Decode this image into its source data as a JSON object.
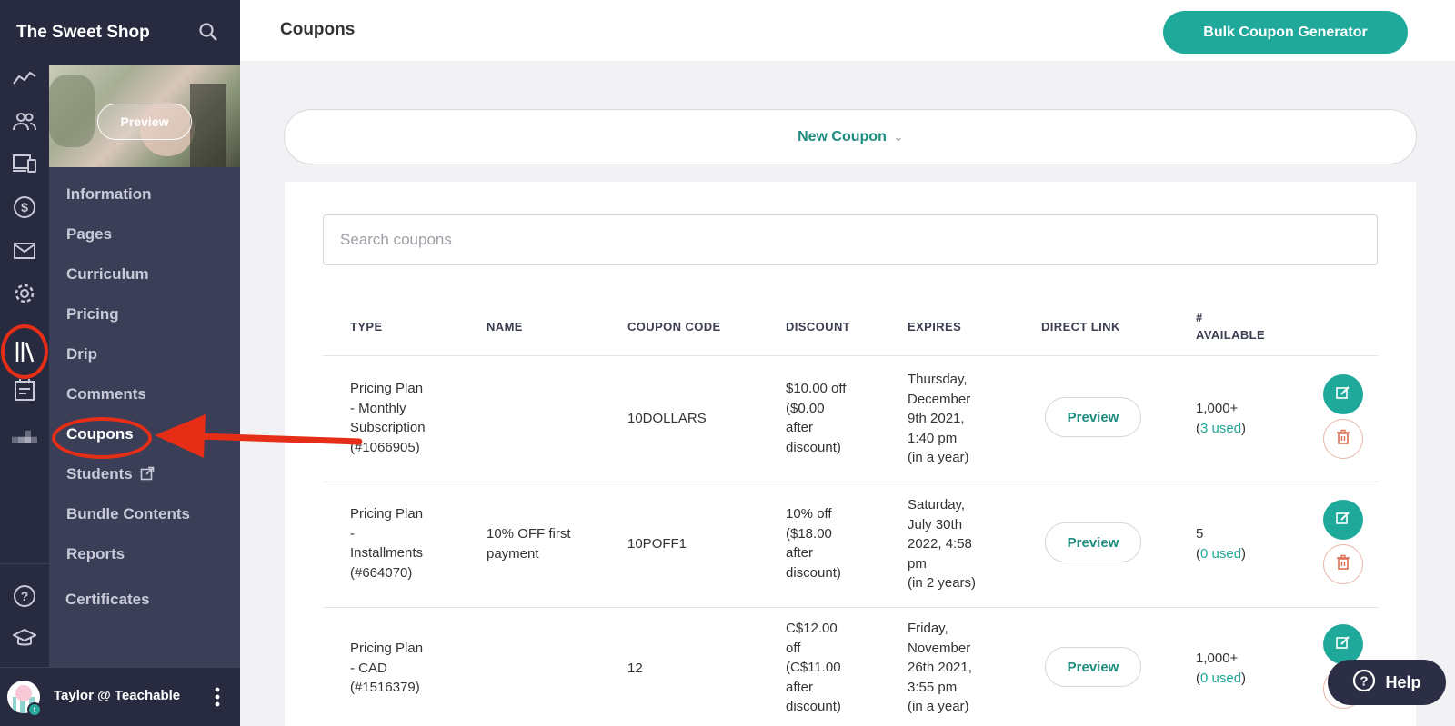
{
  "app": {
    "title": "The Sweet Shop"
  },
  "course_thumb": {
    "preview_label": "Preview"
  },
  "submenu": [
    {
      "label": "Information"
    },
    {
      "label": "Pages"
    },
    {
      "label": "Curriculum"
    },
    {
      "label": "Pricing"
    },
    {
      "label": "Drip"
    },
    {
      "label": "Comments"
    },
    {
      "label": "Coupons"
    },
    {
      "label": "Students"
    },
    {
      "label": "Bundle Contents"
    },
    {
      "label": "Reports"
    },
    {
      "label": "Certificates"
    }
  ],
  "user": {
    "name": "Taylor @ Teachable",
    "badge": "t"
  },
  "header": {
    "title": "Coupons",
    "bulk_button": "Bulk Coupon Generator"
  },
  "new_coupon": {
    "label": "New Coupon"
  },
  "search": {
    "placeholder": "Search coupons"
  },
  "table": {
    "columns": [
      "TYPE",
      "NAME",
      "COUPON CODE",
      "DISCOUNT",
      "EXPIRES",
      "DIRECT LINK",
      "#",
      "AVAILABLE"
    ],
    "preview_label": "Preview",
    "rows": [
      {
        "type": [
          "Pricing Plan",
          "- Monthly",
          "Subscription",
          "(#1066905)"
        ],
        "name": [],
        "code": "10DOLLARS",
        "discount": [
          "$10.00 off",
          "($0.00",
          "after",
          "discount)"
        ],
        "expires": [
          "Thursday,",
          "December",
          "9th 2021,",
          "1:40 pm",
          "(in a year)"
        ],
        "available": "1,000+",
        "used": "3 used"
      },
      {
        "type": [
          "Pricing Plan",
          "-",
          "Installments",
          "(#664070)"
        ],
        "name": [
          "10% OFF first",
          "payment"
        ],
        "code": "10POFF1",
        "discount": [
          "10% off",
          "($18.00",
          "after",
          "discount)"
        ],
        "expires": [
          "Saturday,",
          "July 30th",
          "2022, 4:58",
          "pm",
          "(in 2 years)"
        ],
        "available": "5",
        "used": "0 used"
      },
      {
        "type": [
          "Pricing Plan",
          "- CAD",
          "(#1516379)"
        ],
        "name": [],
        "code": "12",
        "discount": [
          "C$12.00",
          "off",
          "(C$11.00",
          "after",
          "discount)"
        ],
        "expires": [
          "Friday,",
          "November",
          "26th 2021,",
          "3:55 pm",
          "(in a year)"
        ],
        "available": "1,000+",
        "used": "0 used"
      }
    ]
  },
  "help": {
    "label": "Help"
  },
  "colors": {
    "accent": "#1fa99a",
    "sidebar": "#282b3f",
    "submenu": "#3a3e57",
    "annotation": "#e62e17"
  }
}
